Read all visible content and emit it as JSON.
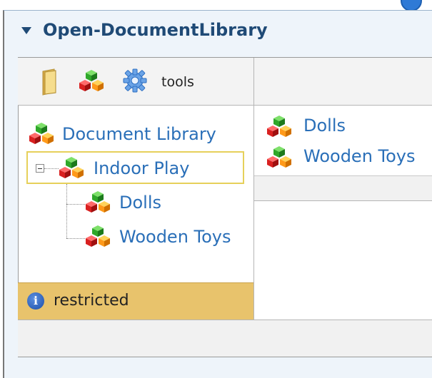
{
  "panel": {
    "title": "Open-DocumentLibrary"
  },
  "toolbar": {
    "tools_label": "tools"
  },
  "tree": {
    "root": "Document Library",
    "selected": "Indoor Play",
    "children": [
      "Dolls",
      "Wooden Toys"
    ]
  },
  "list": {
    "items": [
      "Dolls",
      "Wooden Toys"
    ]
  },
  "status": {
    "restricted_label": "restricted"
  },
  "icons": {
    "collapse": "collapse-arrow-icon",
    "folder": "folder-icon",
    "category": "cubes-icon",
    "settings": "gear-icon",
    "info": "info-icon"
  },
  "colors": {
    "link": "#2a6fb8",
    "title": "#1f4a76",
    "restricted_bg": "#e8c36c",
    "selection_border": "#e6d05a"
  }
}
